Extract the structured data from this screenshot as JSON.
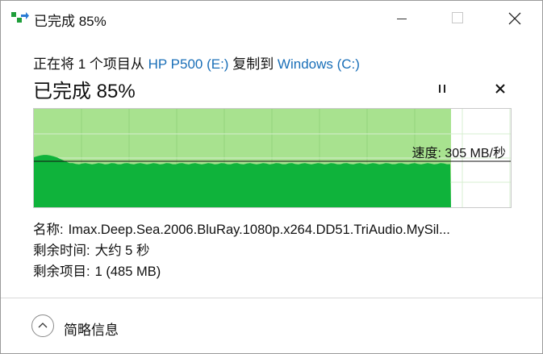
{
  "window": {
    "title": "已完成 85%"
  },
  "copy": {
    "prefix": "正在将 1 个项目从 ",
    "source": "HP P500 (E:)",
    "middle": " 复制到 ",
    "destination": "Windows (C:)"
  },
  "progress": {
    "title": "已完成 85%",
    "percent": 85,
    "speed_text": "速度: 305 MB/秒"
  },
  "details": {
    "name_label": "名称:",
    "name_value": "Imax.Deep.Sea.2006.BluRay.1080p.x264.DD51.TriAudio.MySil...",
    "time_label": "剩余时间:",
    "time_value": "大约 5 秒",
    "items_label": "剩余项目:",
    "items_value": "1 (485 MB)"
  },
  "footer": {
    "toggle_label": "简略信息"
  },
  "colors": {
    "graph_fill": "#0fb33b",
    "graph_progress_bg": "#a8e28f",
    "link": "#1a6fb8"
  }
}
